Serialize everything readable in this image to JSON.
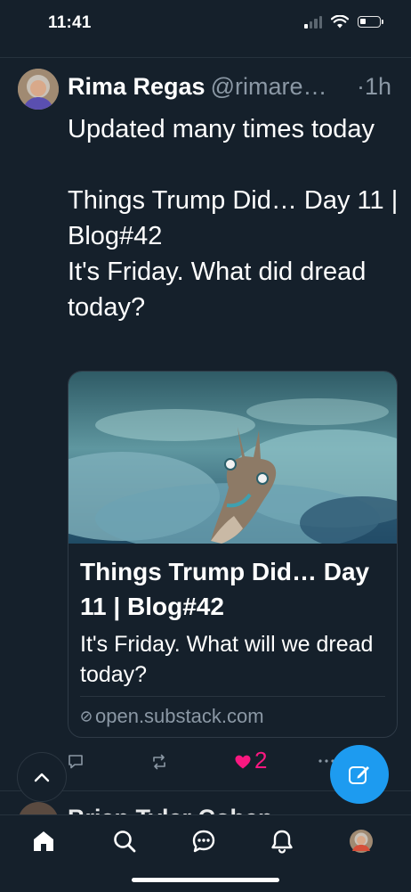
{
  "status_bar": {
    "time": "11:41",
    "signal_bars_active": 1,
    "battery_fraction": 0.35
  },
  "tweet": {
    "author_name": "Rima Regas",
    "handle": "@rimare…",
    "time": "·1h",
    "text_lines": [
      "Updated many times today",
      "",
      "Things Trump Did… Day 11 | Blog#42",
      "It's Friday. What did dread today?"
    ],
    "card": {
      "title": "Things Trump Did… Day 11 | Blog#42",
      "description": "It's Friday. What will we dread today?",
      "domain": "open.substack.com"
    },
    "like_count": "2"
  },
  "next_tweet_peek": "Brian Tyler Cohen",
  "icons": {
    "reply": "reply-icon",
    "retweet": "retweet-icon",
    "like": "heart-icon",
    "more": "more-icon",
    "scroll_top": "chevron-up-icon",
    "compose": "compose-icon",
    "tabs": [
      "home-icon",
      "search-icon",
      "messages-icon",
      "notifications-icon",
      "profile-avatar"
    ]
  },
  "colors": {
    "background": "#15202b",
    "accent": "#1d9bf0",
    "like": "#f91880",
    "secondary_text": "#8b98a5"
  }
}
